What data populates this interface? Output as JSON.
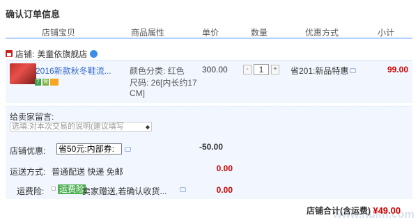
{
  "title": "确认订单信息",
  "columns": {
    "shop_item": "店铺宝贝",
    "attributes": "商品属性",
    "unit_price": "单价",
    "quantity": "数量",
    "discount": "优惠方式",
    "subtotal": "小计"
  },
  "shop": {
    "label": "店铺:",
    "name": "美童依旗舰店"
  },
  "item": {
    "name": "2016新款秋冬鞋流...",
    "color": "颜色分类: 红色",
    "size_line1": "尺码: 26[内长约17",
    "size_line2": "CM]",
    "price": "300.00",
    "quantity": "1",
    "minus": "-",
    "plus": "+",
    "discount": "省201:新品特惠",
    "subtotal": "99.00"
  },
  "memo": {
    "label": "给卖家留言:",
    "placeholder": "选填:对本次交易的说明(建议填写"
  },
  "coupon": {
    "label": "店铺优惠:",
    "selected": "省50元:内部券:",
    "amount": "-50.00"
  },
  "shipping": {
    "label": "运送方式:",
    "method": "普通配送 快递 免邮",
    "amount": "0.00"
  },
  "insurance": {
    "label": "运费险:",
    "tag": "运费险",
    "desc": "卖家赠送,若确认收货...",
    "amount": "0.00"
  },
  "total": {
    "label": "店铺合计(含运费)",
    "amount": "¥49.00"
  },
  "watermark": "www.huim.com",
  "colors": {
    "price_red": "#cc0000",
    "link_blue": "#3366cc",
    "row_bg": "#f2f7ff",
    "header_line": "#b2d1ff",
    "insurance_green": "#4caf50"
  }
}
